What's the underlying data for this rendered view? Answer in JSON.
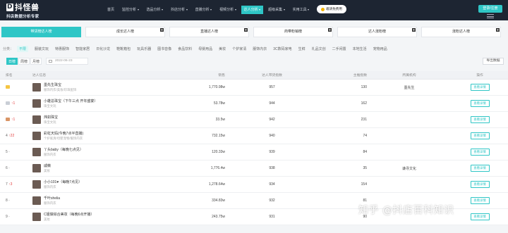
{
  "brand": {
    "name": "抖怪兽",
    "tagline": "抖店数据分析专家",
    "logo_letter": "D"
  },
  "nav": [
    {
      "label": "首页",
      "caret": false,
      "active": false
    },
    {
      "label": "监控分析",
      "caret": true,
      "active": false
    },
    {
      "label": "选品分析",
      "caret": true,
      "active": false
    },
    {
      "label": "抖店分析",
      "caret": true,
      "active": false
    },
    {
      "label": "直播分析",
      "caret": true,
      "active": false
    },
    {
      "label": "视频分析",
      "caret": true,
      "active": false
    },
    {
      "label": "达人分析",
      "caret": true,
      "active": true
    },
    {
      "label": "超级采集",
      "caret": true,
      "active": false
    },
    {
      "label": "实用工具",
      "caret": true,
      "active": false
    }
  ],
  "vip_button": "邀请免费用",
  "login_button": "登录/注册",
  "rank_tabs": [
    {
      "label": "带货榜达人榜",
      "active": true
    },
    {
      "label": "成长达人榜",
      "active": false
    },
    {
      "label": "直播达人榜",
      "active": false
    },
    {
      "label": "商带粉销榜",
      "active": false
    },
    {
      "label": "达人涨粉榜",
      "active": false
    },
    {
      "label": "涨粉达人榜",
      "active": false
    }
  ],
  "filter_label": "分类：",
  "filters": [
    {
      "label": "不限",
      "active": true
    },
    {
      "label": "服装文玩",
      "active": false
    },
    {
      "label": "特惠服饰",
      "active": false
    },
    {
      "label": "智能家居",
      "active": false
    },
    {
      "label": "日化沙龙",
      "active": false
    },
    {
      "label": "鞋靴箱包",
      "active": false
    },
    {
      "label": "玩具乐器",
      "active": false
    },
    {
      "label": "图书音像",
      "active": false
    },
    {
      "label": "食品饮料",
      "active": false
    },
    {
      "label": "母婴用品",
      "active": false
    },
    {
      "label": "美妆",
      "active": false
    },
    {
      "label": "个护家清",
      "active": false
    },
    {
      "label": "服饰内衣",
      "active": false
    },
    {
      "label": "3C数码家电",
      "active": false
    },
    {
      "label": "生鲜",
      "active": false
    },
    {
      "label": "礼品文创",
      "active": false
    },
    {
      "label": "二手闲置",
      "active": false
    },
    {
      "label": "本地生活",
      "active": false
    },
    {
      "label": "宠物用品",
      "active": false
    }
  ],
  "periods": [
    {
      "label": "日榜",
      "active": true
    },
    {
      "label": "周榜",
      "active": false
    },
    {
      "label": "月榜",
      "active": false
    }
  ],
  "date_value": "2022-06-23",
  "export_label": "导出数据",
  "table": {
    "headers": [
      "排名",
      "达人信息",
      "销售",
      "达人带货指数",
      "主推指数",
      "所属机构",
      "操作"
    ],
    "rows": [
      {
        "rank": "",
        "rank_icon": "gold-crown",
        "trend": "",
        "name": "墨先生珠宝",
        "category": "服饰内衣/美妆/珍珠配饰",
        "sales": "1,770.98w",
        "fans": "957",
        "score": "130",
        "org": "墨先生",
        "op": "查看详情"
      },
      {
        "rank": "",
        "rank_icon": "silver-crown",
        "trend": "↑1",
        "name": "小雄总珠宝（下午三点 开年盛宴）",
        "category": "珠宝文玩",
        "sales": "53.78w",
        "fans": "944",
        "score": "162",
        "org": "",
        "op": "查看详情"
      },
      {
        "rank": "",
        "rank_icon": "bronze-crown",
        "trend": "↑1",
        "name": "炜如珠宝",
        "category": "珠宝文玩",
        "sales": "33.5w",
        "fans": "942",
        "score": "231",
        "org": "",
        "op": "查看详情"
      },
      {
        "rank": "4",
        "rank_icon": "",
        "trend": "↑22",
        "name": "彩虹天妈(今晚7点半直播)",
        "category": "个护家清/母婴宠物/服饰内衣",
        "sales": "732.15w",
        "fans": "940",
        "score": "74",
        "org": "",
        "op": "查看详情"
      },
      {
        "rank": "5",
        "rank_icon": "",
        "trend": "-",
        "name": "丫头baby（每晚七点见）",
        "category": "服饰内衣",
        "sales": "120.33w",
        "fans": "939",
        "score": "84",
        "org": "",
        "op": "查看详情"
      },
      {
        "rank": "6",
        "rank_icon": "",
        "trend": "-",
        "name": "戚薇",
        "category": "美妆",
        "sales": "1,776.4w",
        "fans": "938",
        "score": "35",
        "org": "谦寻文化",
        "op": "查看详情"
      },
      {
        "rank": "7",
        "rank_icon": "",
        "trend": "↑3",
        "name": "小小101♥（每晚7点见）",
        "category": "服饰内衣",
        "sales": "1,278.64w",
        "fans": "934",
        "score": "154",
        "org": "",
        "op": "查看详情"
      },
      {
        "rank": "8",
        "rank_icon": "",
        "trend": "-",
        "name": "千叶shelia",
        "category": "服饰内衣",
        "sales": "334.83w",
        "fans": "932",
        "score": "81",
        "org": "",
        "op": "查看详情"
      },
      {
        "rank": "9",
        "rank_icon": "",
        "trend": "-",
        "name": "C姐做综合美妆（每晚6点开播）",
        "category": "美妆",
        "sales": "243.75w",
        "fans": "931",
        "score": "90",
        "org": "",
        "op": "查看详情"
      }
    ]
  },
  "watermark": "知乎 @抖店百科知识",
  "colors": {
    "accent": "#2fc6c6",
    "nav_bg": "#1d2532",
    "up": "#e43b3b",
    "gold": "#f5c542",
    "silver": "#c9ced6",
    "bronze": "#d99566"
  }
}
